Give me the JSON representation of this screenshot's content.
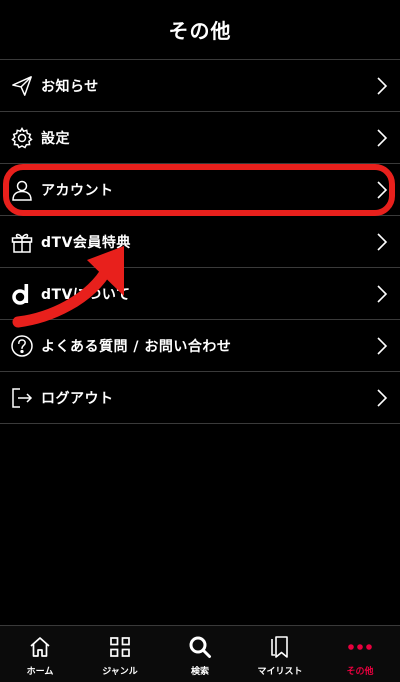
{
  "header": {
    "title": "その他"
  },
  "menu": {
    "items": [
      {
        "label": "お知らせ",
        "icon": "paper-plane-icon"
      },
      {
        "label": "設定",
        "icon": "gear-icon"
      },
      {
        "label": "アカウント",
        "icon": "person-icon"
      },
      {
        "label": "dTV会員特典",
        "icon": "gift-icon"
      },
      {
        "label": "dTVについて",
        "icon": "dtv-logo-icon"
      },
      {
        "label": "よくある質問 / お問い合わせ",
        "icon": "question-circle-icon"
      },
      {
        "label": "ログアウト",
        "icon": "logout-icon"
      }
    ]
  },
  "tabbar": {
    "items": [
      {
        "label": "ホーム",
        "icon": "home-icon"
      },
      {
        "label": "ジャンル",
        "icon": "grid-icon"
      },
      {
        "label": "検索",
        "icon": "search-icon"
      },
      {
        "label": "マイリスト",
        "icon": "bookmark-list-icon"
      },
      {
        "label": "その他",
        "icon": "more-dots-icon",
        "active": true
      }
    ]
  },
  "colors": {
    "background": "#000000",
    "divider": "#3a3a3a",
    "highlight": "#e8201c",
    "active_tab": "#e8003e"
  }
}
